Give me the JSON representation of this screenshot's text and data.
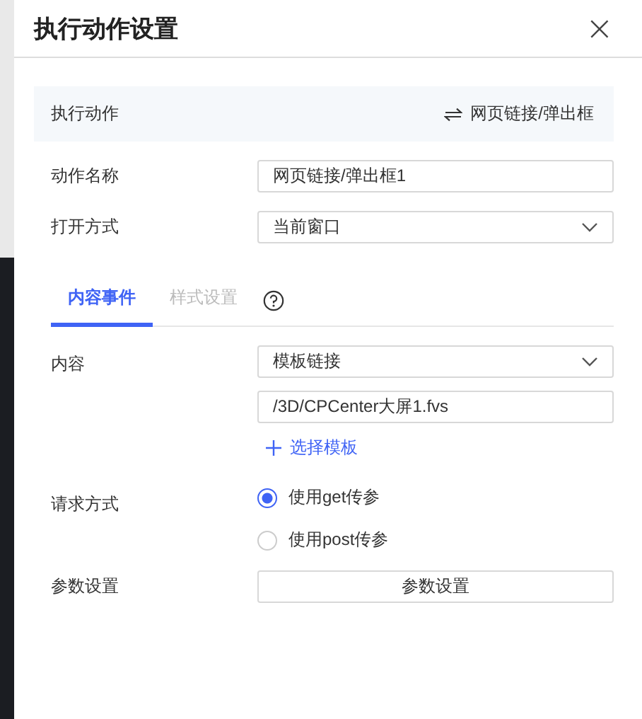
{
  "dialog": {
    "title": "执行动作设置",
    "close": "×"
  },
  "action_bar": {
    "label": "执行动作",
    "value": "网页链接/弹出框"
  },
  "fields": [
    {
      "kind": "input",
      "label": "动作名称",
      "value": "网页链接/弹出框1"
    },
    {
      "kind": "select",
      "label": "打开方式",
      "value": "当前窗口"
    }
  ],
  "tabs": [
    {
      "label": "内容事件",
      "selected": true
    },
    {
      "label": "样式设置",
      "selected": false
    }
  ],
  "content": {
    "label": "内容",
    "select_value": "模板链接",
    "path_value": "/3D/CPCenter大屏1.fvs",
    "link": "选择模板"
  },
  "request": {
    "label": "请求方式",
    "options": [
      {
        "label": "使用get传参",
        "selected": true
      },
      {
        "label": "使用post传参",
        "selected": false
      }
    ]
  },
  "params": {
    "label": "参数设置",
    "button": "参数设置"
  }
}
